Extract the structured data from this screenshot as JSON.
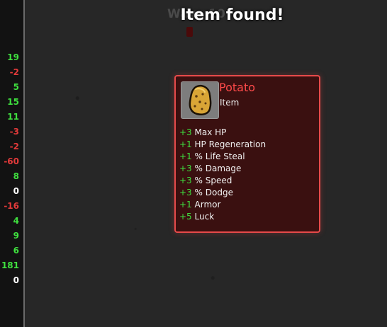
{
  "banner": {
    "title": "Item found!",
    "wave_label": "Wave 10"
  },
  "stats_panel": {
    "values": [
      {
        "text": "19",
        "sign": "pos"
      },
      {
        "text": "-2",
        "sign": "neg"
      },
      {
        "text": "5",
        "sign": "pos"
      },
      {
        "text": "15",
        "sign": "pos"
      },
      {
        "text": "11",
        "sign": "pos"
      },
      {
        "text": "-3",
        "sign": "neg"
      },
      {
        "text": "-2",
        "sign": "neg"
      },
      {
        "text": "-60",
        "sign": "neg"
      },
      {
        "text": "8",
        "sign": "pos"
      },
      {
        "text": "0",
        "sign": "zero"
      },
      {
        "text": "-16",
        "sign": "neg"
      },
      {
        "text": "4",
        "sign": "pos"
      },
      {
        "text": "9",
        "sign": "pos"
      },
      {
        "text": "6",
        "sign": "pos"
      },
      {
        "text": "181",
        "sign": "pos"
      },
      {
        "text": "0",
        "sign": "zero"
      }
    ]
  },
  "item": {
    "name": "Potato",
    "type": "Item",
    "icon": "potato-icon",
    "effects": [
      {
        "amount": "+3",
        "text": "Max HP"
      },
      {
        "amount": "+1",
        "text": "HP Regeneration"
      },
      {
        "amount": "+1",
        "text": "% Life Steal"
      },
      {
        "amount": "+3",
        "text": "% Damage"
      },
      {
        "amount": "+3",
        "text": "% Speed"
      },
      {
        "amount": "+3",
        "text": "% Dodge"
      },
      {
        "amount": "+1",
        "text": "Armor"
      },
      {
        "amount": "+5",
        "text": "Luck"
      }
    ]
  },
  "colors": {
    "positive": "#3fe03f",
    "negative": "#e23a3a",
    "item_name": "#ff4a4a",
    "card_border": "#e64a4a",
    "card_bg": "#3a1010"
  }
}
